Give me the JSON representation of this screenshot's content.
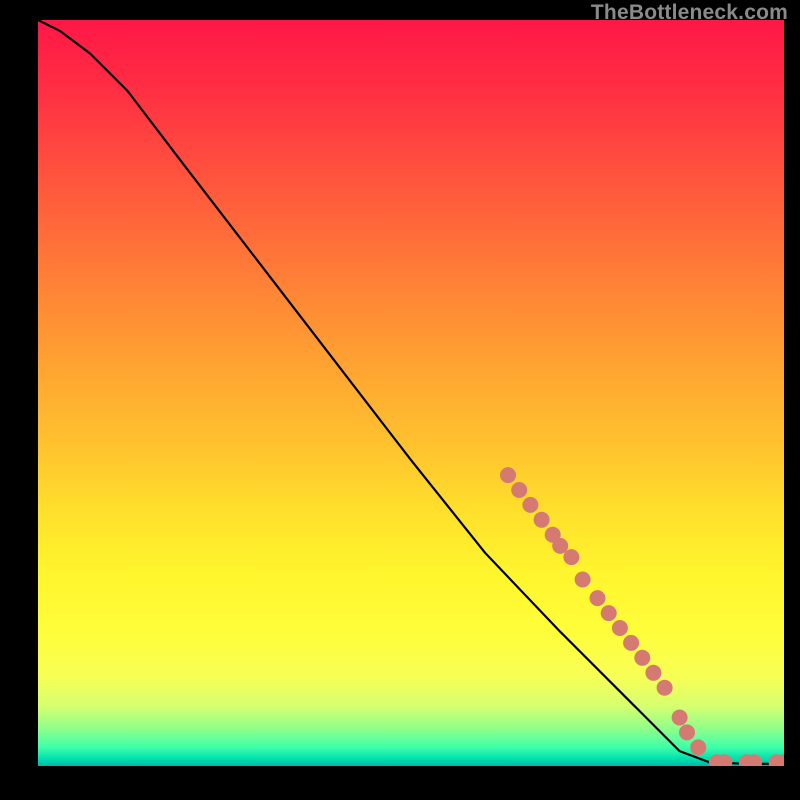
{
  "watermark": "TheBottleneck.com",
  "colors": {
    "curve": "#000000",
    "marker_fill": "#d57a72",
    "marker_stroke": "#c86b63",
    "background_black": "#000000"
  },
  "chart_data": {
    "type": "line",
    "title": "",
    "xlabel": "",
    "ylabel": "",
    "xlim": [
      0,
      100
    ],
    "ylim": [
      0,
      100
    ],
    "grid": false,
    "legend": false,
    "curve": [
      {
        "x": 0,
        "y": 100
      },
      {
        "x": 3,
        "y": 98.5
      },
      {
        "x": 7,
        "y": 95.5
      },
      {
        "x": 12,
        "y": 90.5
      },
      {
        "x": 20,
        "y": 80
      },
      {
        "x": 30,
        "y": 67
      },
      {
        "x": 40,
        "y": 54
      },
      {
        "x": 50,
        "y": 41
      },
      {
        "x": 60,
        "y": 28.5
      },
      {
        "x": 70,
        "y": 18
      },
      {
        "x": 80,
        "y": 8
      },
      {
        "x": 86,
        "y": 2
      },
      {
        "x": 90,
        "y": 0.5
      },
      {
        "x": 95,
        "y": 0.3
      },
      {
        "x": 100,
        "y": 0.3
      }
    ],
    "markers": [
      {
        "x": 63,
        "y": 39
      },
      {
        "x": 64.5,
        "y": 37
      },
      {
        "x": 66,
        "y": 35
      },
      {
        "x": 67.5,
        "y": 33
      },
      {
        "x": 69,
        "y": 31
      },
      {
        "x": 70,
        "y": 29.5
      },
      {
        "x": 71.5,
        "y": 28
      },
      {
        "x": 73,
        "y": 25
      },
      {
        "x": 75,
        "y": 22.5
      },
      {
        "x": 76.5,
        "y": 20.5
      },
      {
        "x": 78,
        "y": 18.5
      },
      {
        "x": 79.5,
        "y": 16.5
      },
      {
        "x": 81,
        "y": 14.5
      },
      {
        "x": 82.5,
        "y": 12.5
      },
      {
        "x": 84,
        "y": 10.5
      },
      {
        "x": 86,
        "y": 6.5
      },
      {
        "x": 87,
        "y": 4.5
      },
      {
        "x": 88.5,
        "y": 2.5
      },
      {
        "x": 91,
        "y": 0.5
      },
      {
        "x": 92,
        "y": 0.5
      },
      {
        "x": 95,
        "y": 0.5
      },
      {
        "x": 96,
        "y": 0.5
      },
      {
        "x": 99,
        "y": 0.5
      },
      {
        "x": 100,
        "y": 0.5
      }
    ],
    "marker_radius_px": 8
  }
}
